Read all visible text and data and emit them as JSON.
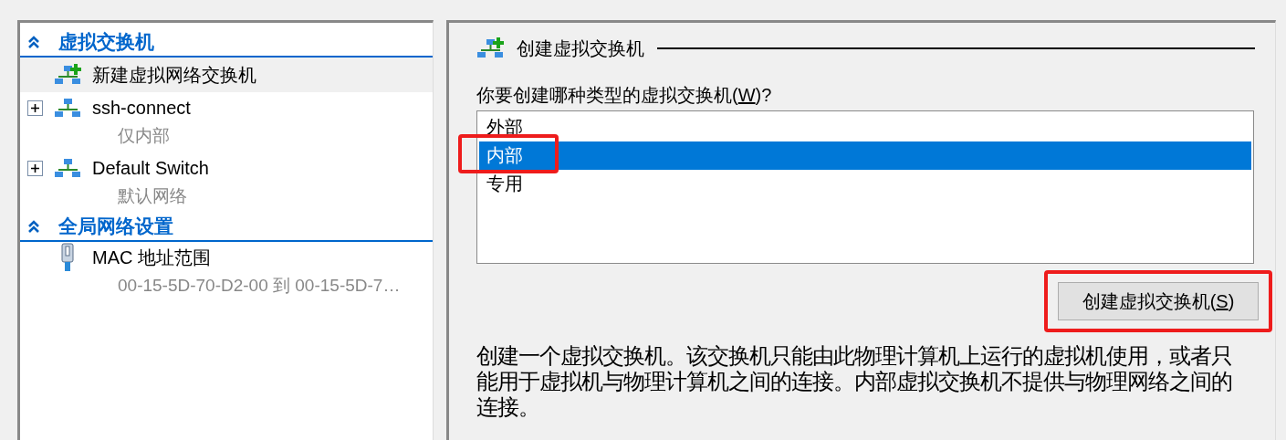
{
  "sidebar": {
    "sections": [
      {
        "title": "虚拟交换机",
        "expanded": true,
        "items": [
          {
            "kind": "action",
            "label": "新建虚拟网络交换机",
            "selected": true
          },
          {
            "kind": "switch",
            "label": "ssh-connect",
            "subtitle": "仅内部",
            "expanded": false,
            "selected": false
          },
          {
            "kind": "switch",
            "label": "Default Switch",
            "subtitle": "默认网络",
            "expanded": false,
            "selected": false
          }
        ]
      },
      {
        "title": "全局网络设置",
        "expanded": true,
        "items": [
          {
            "kind": "mac",
            "label": "MAC 地址范围",
            "subtitle": "00-15-5D-70-D2-00 到 00-15-5D-7…",
            "selected": false
          }
        ]
      }
    ]
  },
  "panel": {
    "title": "创建虚拟交换机",
    "question": {
      "prefix": "你要创建哪种类型的虚拟交换机(",
      "mnemonic": "W",
      "suffix": ")?"
    },
    "options": [
      {
        "label": "外部",
        "selected": false,
        "highlighted": false
      },
      {
        "label": "内部",
        "selected": true,
        "highlighted": true
      },
      {
        "label": "专用",
        "selected": false,
        "highlighted": false
      }
    ],
    "button": {
      "prefix": "创建虚拟交换机(",
      "mnemonic": "S",
      "suffix": ")",
      "highlighted": true
    },
    "description": "创建一个虚拟交换机。该交换机只能由此物理计算机上运行的虚拟机使用，或者只能用于虚拟机与物理计算机之间的连接。内部虚拟交换机不提供与物理网络之间的连接。"
  }
}
